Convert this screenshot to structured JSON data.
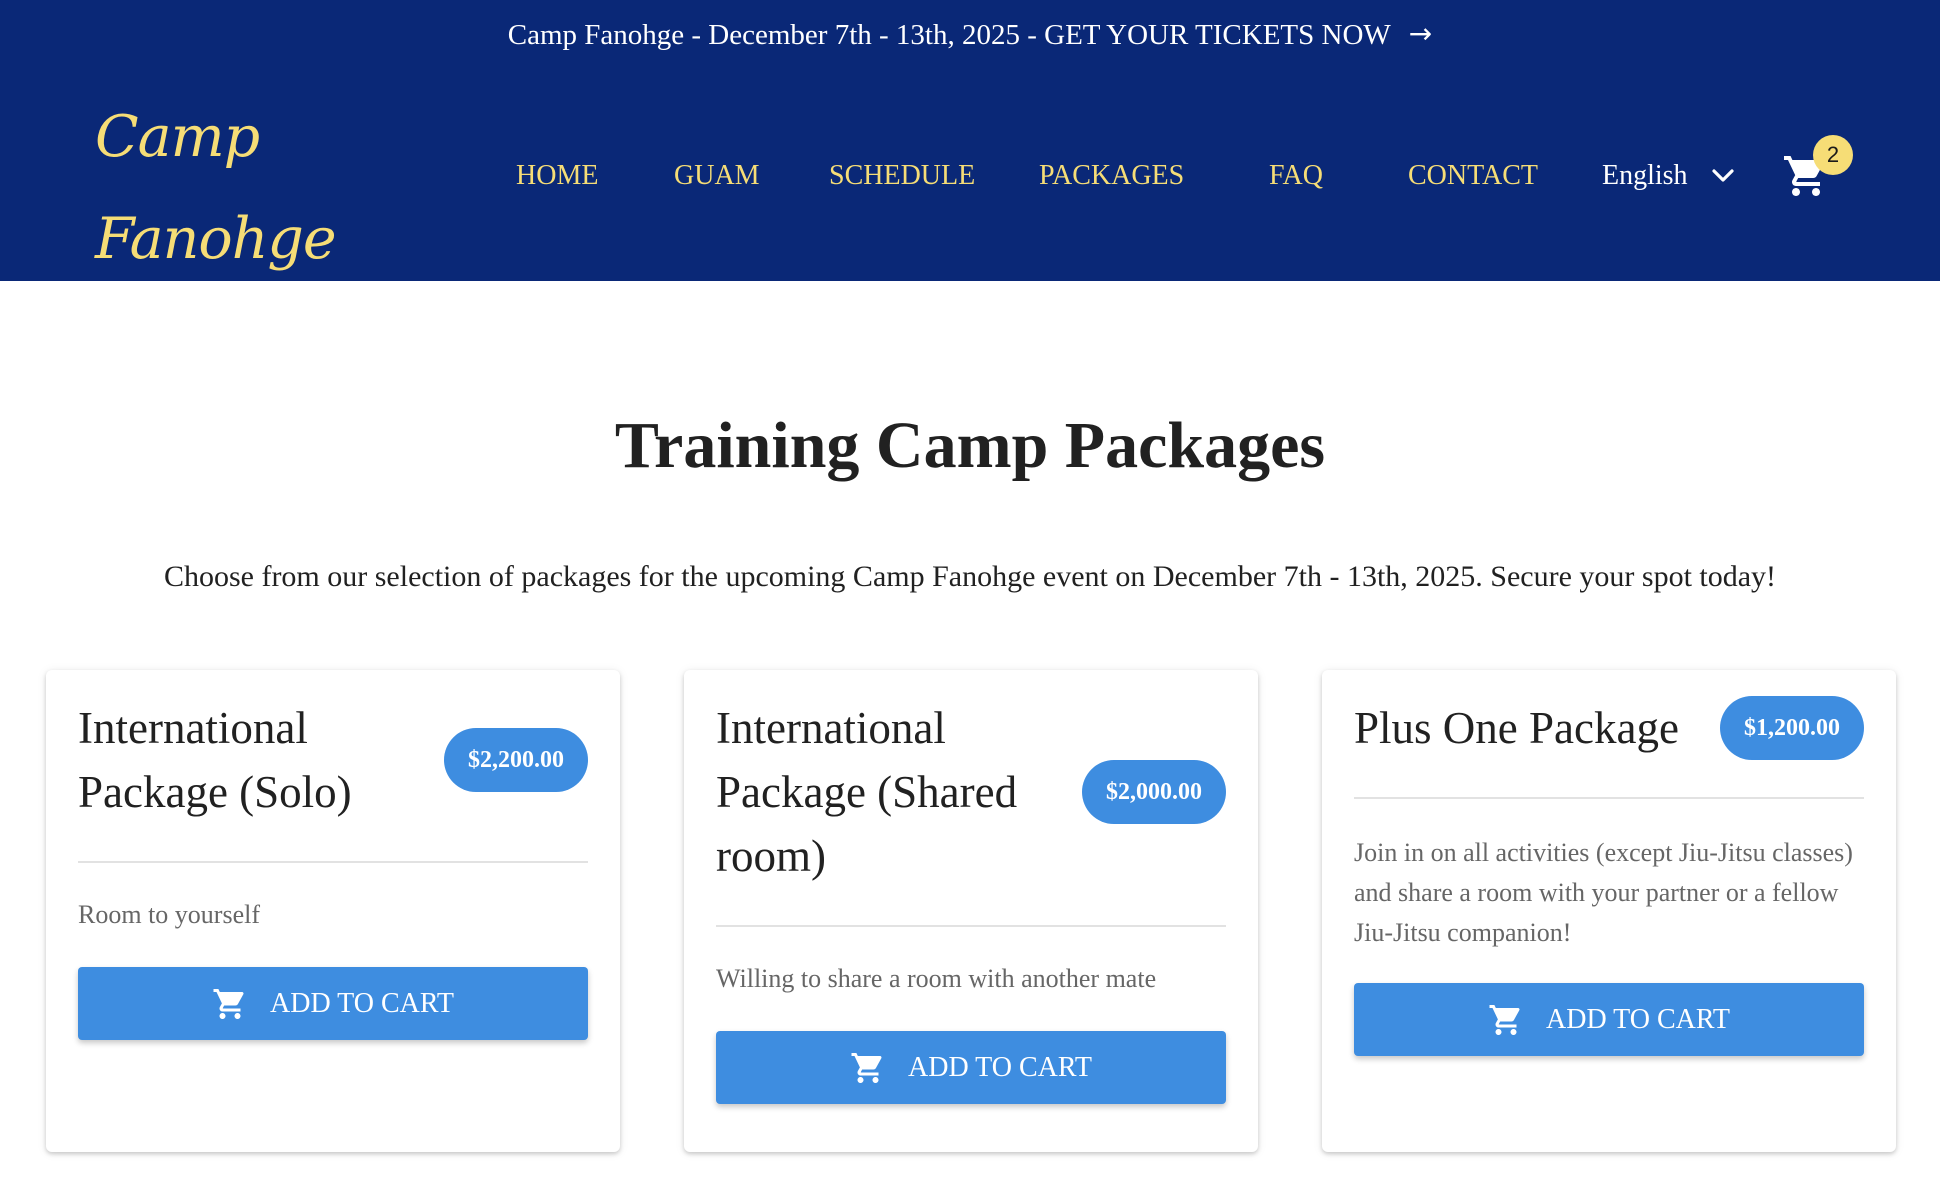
{
  "announcement": {
    "text": "Camp Fanohge - December 7th - 13th, 2025 - GET YOUR TICKETS NOW",
    "arrow": "→"
  },
  "logo": {
    "line1": "Camp",
    "line2": "Fanohge"
  },
  "nav": {
    "items": [
      {
        "label": "HOME"
      },
      {
        "label": "GUAM"
      },
      {
        "label": "SCHEDULE"
      },
      {
        "label": "PACKAGES"
      },
      {
        "label": "FAQ"
      },
      {
        "label": "CONTACT"
      }
    ],
    "language": "English",
    "cart_count": "2"
  },
  "main": {
    "title": "Training Camp Packages",
    "subtitle": "Choose from our selection of packages for the upcoming Camp Fanohge event on December 7th - 13th, 2025. Secure your spot today!"
  },
  "packages": [
    {
      "title": "International Package (Solo)",
      "price": "$2,200.00",
      "description": "Room to yourself",
      "button": "ADD TO CART"
    },
    {
      "title": "International Package (Shared room)",
      "price": "$2,000.00",
      "description": "Willing to share a room with another mate",
      "button": "ADD TO CART"
    },
    {
      "title": "Plus One Package",
      "price": "$1,200.00",
      "description": "Join in on all activities (except Jiu-Jitsu classes) and share a room with your partner or a fellow Jiu-Jitsu companion!",
      "button": "ADD TO CART"
    }
  ],
  "colors": {
    "header_bg": "#0a2877",
    "accent_yellow": "#f6dd76",
    "button_blue": "#3e8de0"
  },
  "icons": {
    "cart": "shopping-cart-icon",
    "language_chevron": "chevron-down-icon",
    "banner_arrow": "arrow-right-icon"
  }
}
